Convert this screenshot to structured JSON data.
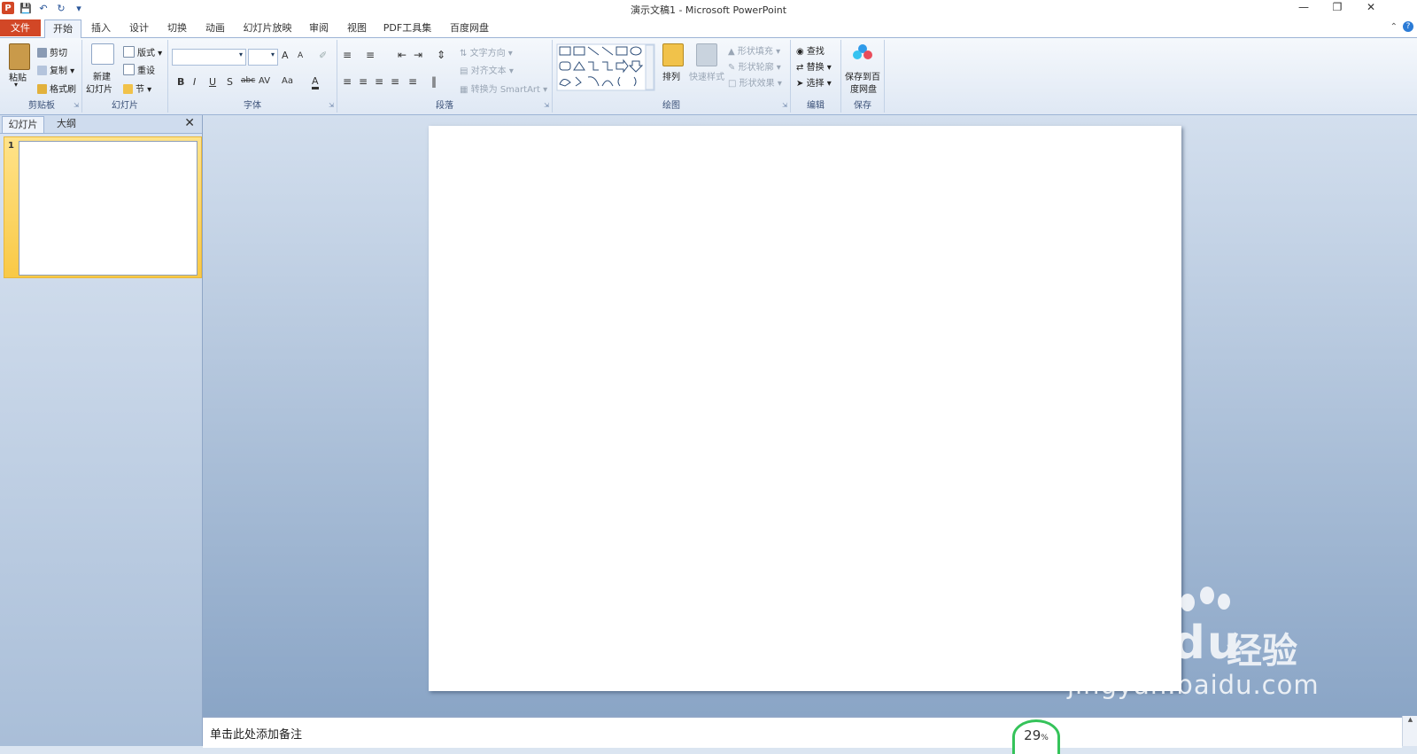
{
  "window": {
    "title": "演示文稿1 - Microsoft PowerPoint",
    "controls": [
      "minimize",
      "restore",
      "close"
    ]
  },
  "qat": {
    "app_icon": "P"
  },
  "ribbon_tabs": [
    {
      "label": "文件"
    },
    {
      "label": "开始"
    },
    {
      "label": "插入"
    },
    {
      "label": "设计"
    },
    {
      "label": "切换"
    },
    {
      "label": "动画"
    },
    {
      "label": "幻灯片放映"
    },
    {
      "label": "审阅"
    },
    {
      "label": "视图"
    },
    {
      "label": "PDF工具集"
    },
    {
      "label": "百度网盘"
    }
  ],
  "groups": {
    "clipboard": {
      "label": "剪贴板",
      "paste": "粘贴",
      "cut": "剪切",
      "copy": "复制",
      "format_painter": "格式刷"
    },
    "slides": {
      "label": "幻灯片",
      "new_slide_line1": "新建",
      "new_slide_line2": "幻灯片",
      "layout": "版式",
      "reset": "重设",
      "section": "节"
    },
    "font": {
      "label": "字体",
      "bold": "B",
      "italic": "I",
      "underline": "U",
      "shadow": "S",
      "strike": "abc",
      "spacing": "AV",
      "case": "Aa",
      "color": "A",
      "grow": "A",
      "shrink": "A"
    },
    "paragraph": {
      "label": "段落",
      "text_direction": "文字方向",
      "align_text": "对齐文本",
      "smartart": "转换为 SmartArt"
    },
    "drawing": {
      "label": "绘图",
      "arrange": "排列",
      "quick_styles": "快速样式",
      "shape_fill": "形状填充",
      "shape_outline": "形状轮廓",
      "shape_effects": "形状效果"
    },
    "editing": {
      "label": "编辑",
      "find": "查找",
      "replace": "替换",
      "select": "选择"
    },
    "save": {
      "label": "保存",
      "save_baidu_line1": "保存到百",
      "save_baidu_line2": "度网盘"
    }
  },
  "left_pane": {
    "tabs": [
      {
        "label": "幻灯片"
      },
      {
        "label": "大纲"
      }
    ],
    "slide_number": "1"
  },
  "notes": {
    "placeholder": "单击此处添加备注"
  },
  "zoom_badge": {
    "value": "29",
    "unit": "%"
  },
  "watermark": {
    "brand": "Bai du",
    "cn": "经验",
    "url": "jingyan.baidu.com"
  },
  "colors": {
    "file_tab": "#d24726",
    "ribbon": "#dfe8f4",
    "workspace": "#8aa5c6",
    "selected_thumb": "#f9c946",
    "zoom_ring": "#35c35a"
  }
}
